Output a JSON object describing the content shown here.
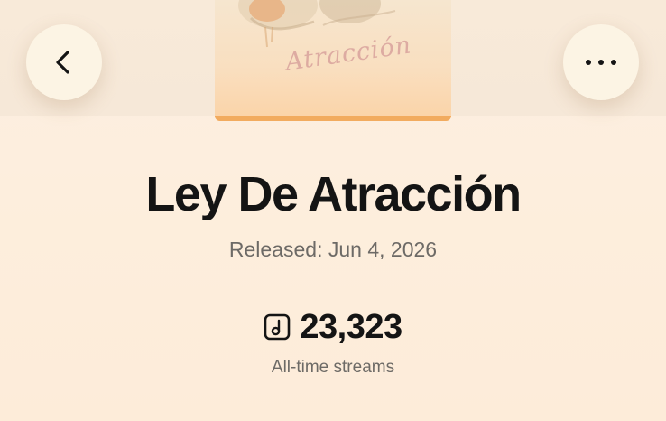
{
  "header": {
    "back_icon": "chevron-left-icon",
    "more_icon": "more-horizontal-icon"
  },
  "cover": {
    "script_text": "Atracción",
    "progress": 1.0,
    "progress_color": "#f2ab5f"
  },
  "track": {
    "title": "Ley De Atracción",
    "released": "Released: Jun 4, 2026"
  },
  "stats": {
    "icon": "music-note-square-icon",
    "streams_value": "23,323",
    "streams_label": "All-time streams"
  }
}
